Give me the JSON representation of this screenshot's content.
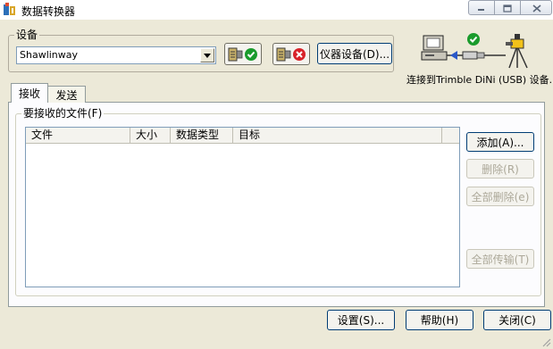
{
  "window": {
    "title": "数据转换器"
  },
  "device_group": {
    "label": "设备",
    "combo_value": "Shawlinway",
    "connect_button_icon": "connect-icon",
    "disconnect_button_icon": "disconnect-icon",
    "instrument_settings_label": "仪器设备(D)..."
  },
  "connection": {
    "status_text": "连接到Trimble DiNi (USB) 设备."
  },
  "tabs": [
    {
      "label": "接收"
    },
    {
      "label": "发送"
    }
  ],
  "files_group": {
    "label": "要接收的文件(F)",
    "columns": [
      {
        "label": "文件"
      },
      {
        "label": "大小"
      },
      {
        "label": "数据类型"
      },
      {
        "label": "目标"
      }
    ],
    "rows": []
  },
  "side_buttons": {
    "add": "添加(A)...",
    "delete": "删除(R)",
    "delete_all": "全部删除(e)",
    "transfer_all": "全部传输(T)"
  },
  "bottom_buttons": {
    "settings": "设置(S)...",
    "help": "帮助(H)",
    "close": "关闭(C)"
  },
  "colors": {
    "window_bg": "#ece9d8",
    "button_border": "#003c74",
    "disabled_text": "#aca899",
    "check_green": "#1a9b2c",
    "cross_red": "#d8232a"
  }
}
